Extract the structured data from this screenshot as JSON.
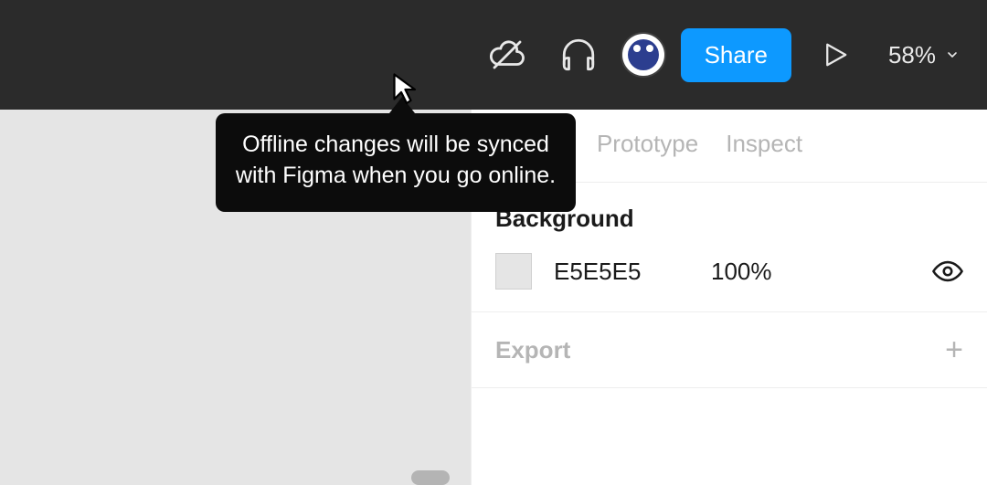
{
  "toolbar": {
    "share_label": "Share",
    "zoom_label": "58%"
  },
  "tooltip": {
    "text": "Offline changes will be synced with Figma when you go online."
  },
  "panel": {
    "tabs": {
      "prototype": "Prototype",
      "inspect": "Inspect"
    },
    "background": {
      "title": "Background",
      "hex": "E5E5E5",
      "opacity": "100%"
    },
    "export": {
      "title": "Export"
    }
  }
}
